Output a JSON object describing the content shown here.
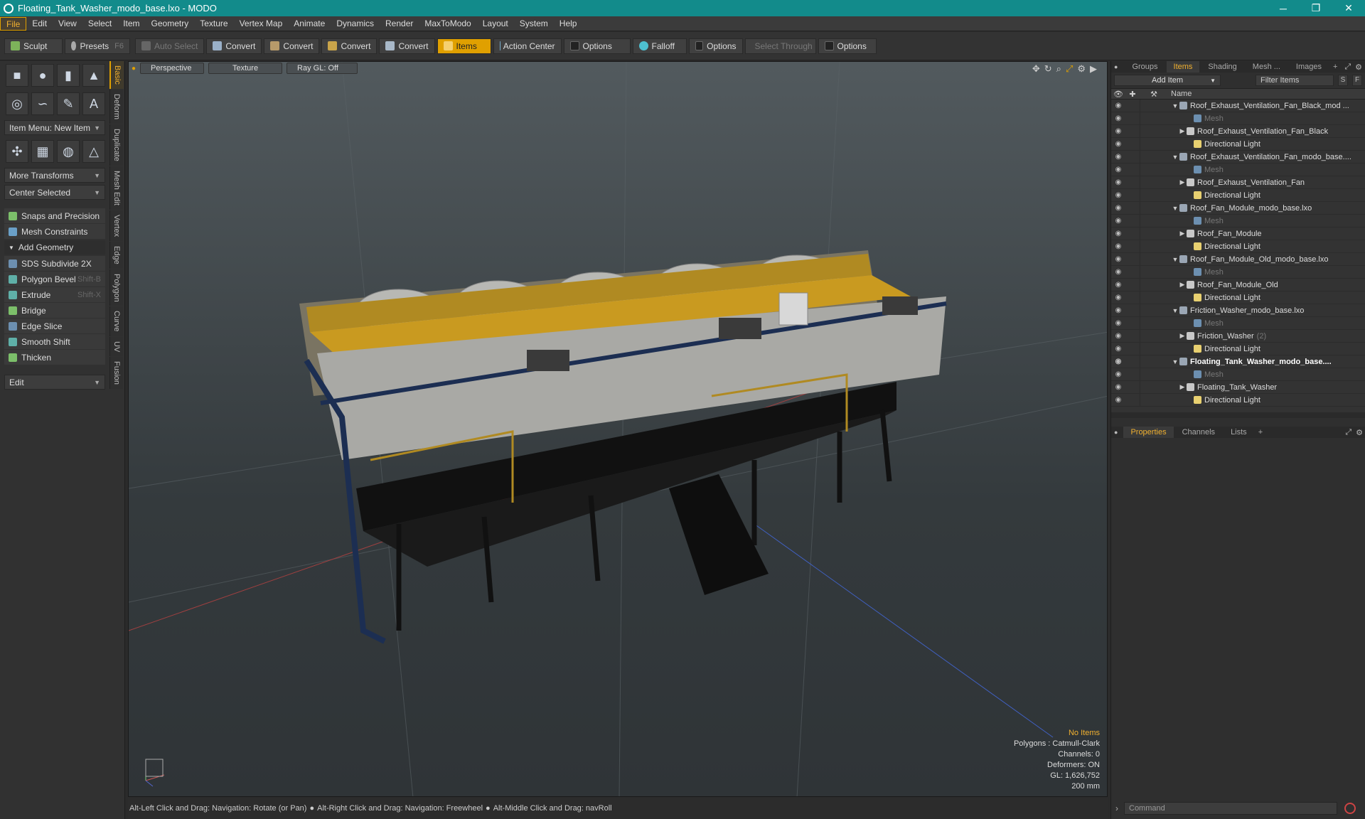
{
  "window": {
    "title": "Floating_Tank_Washer_modo_base.lxo - MODO",
    "min": "─",
    "max": "❐",
    "close": "✕"
  },
  "menu": [
    "File",
    "Edit",
    "View",
    "Select",
    "Item",
    "Geometry",
    "Texture",
    "Vertex Map",
    "Animate",
    "Dynamics",
    "Render",
    "MaxToModo",
    "Layout",
    "System",
    "Help"
  ],
  "toolbar": {
    "sculpt": "Sculpt",
    "presets": "Presets",
    "presets_key": "F6",
    "auto_select": "Auto Select",
    "convert": "Convert",
    "items": "Items",
    "action_center": "Action Center",
    "options": "Options",
    "falloff": "Falloff",
    "select_through": "Select Through"
  },
  "left": {
    "item_menu": "Item Menu: New Item",
    "more_transforms": "More Transforms",
    "center_selected": "Center Selected",
    "snaps": "Snaps and Precision",
    "mesh_constraints": "Mesh Constraints",
    "add_geometry": "Add Geometry",
    "tools": [
      {
        "label": "SDS Subdivide 2X",
        "key": ""
      },
      {
        "label": "Polygon Bevel",
        "key": "Shift-B"
      },
      {
        "label": "Extrude",
        "key": "Shift-X"
      },
      {
        "label": "Bridge",
        "key": ""
      },
      {
        "label": "Edge Slice",
        "key": ""
      },
      {
        "label": "Smooth Shift",
        "key": ""
      },
      {
        "label": "Thicken",
        "key": ""
      }
    ],
    "edit": "Edit",
    "vtabs": [
      "Basic",
      "Deform",
      "Duplicate",
      "Mesh Edit",
      "Vertex",
      "Edge",
      "Polygon",
      "Curve",
      "UV",
      "Fusion"
    ]
  },
  "viewport": {
    "perspective": "Perspective",
    "texture": "Texture",
    "raygl": "Ray GL: Off",
    "stats": {
      "no_items": "No Items",
      "polygons": "Polygons : Catmull-Clark",
      "channels": "Channels: 0",
      "deformers": "Deformers: ON",
      "gl": "GL: 1,626,752",
      "size": "200 mm"
    }
  },
  "status": {
    "hint1": "Alt-Left Click and Drag: Navigation: Rotate (or Pan)",
    "hint2": "Alt-Right Click and Drag: Navigation: Freewheel",
    "hint3": "Alt-Middle Click and Drag: navRoll"
  },
  "right": {
    "tabs": [
      "Groups",
      "Items",
      "Shading",
      "Mesh ...",
      "Images",
      "+"
    ],
    "add_item": "Add Item",
    "filter": "Filter Items",
    "s": "S",
    "f": "F",
    "name_col": "Name",
    "rows": [
      {
        "label": "Roof_Exhaust_Ventilation_Fan_Black_mod ...",
        "type": "scene",
        "indent": 0,
        "arrow": "▼"
      },
      {
        "label": "Mesh",
        "type": "mesh",
        "indent": 2,
        "arrow": ""
      },
      {
        "label": "Roof_Exhaust_Ventilation_Fan_Black",
        "type": "item",
        "indent": 1,
        "arrow": "▶"
      },
      {
        "label": "Directional Light",
        "type": "light",
        "indent": 2,
        "arrow": ""
      },
      {
        "label": "Roof_Exhaust_Ventilation_Fan_modo_base....",
        "type": "scene",
        "indent": 0,
        "arrow": "▼"
      },
      {
        "label": "Mesh",
        "type": "mesh",
        "indent": 2,
        "arrow": ""
      },
      {
        "label": "Roof_Exhaust_Ventilation_Fan",
        "type": "item",
        "indent": 1,
        "arrow": "▶"
      },
      {
        "label": "Directional Light",
        "type": "light",
        "indent": 2,
        "arrow": ""
      },
      {
        "label": "Roof_Fan_Module_modo_base.lxo",
        "type": "scene",
        "indent": 0,
        "arrow": "▼"
      },
      {
        "label": "Mesh",
        "type": "mesh",
        "indent": 2,
        "arrow": ""
      },
      {
        "label": "Roof_Fan_Module",
        "type": "item",
        "indent": 1,
        "arrow": "▶"
      },
      {
        "label": "Directional Light",
        "type": "light",
        "indent": 2,
        "arrow": ""
      },
      {
        "label": "Roof_Fan_Module_Old_modo_base.lxo",
        "type": "scene",
        "indent": 0,
        "arrow": "▼"
      },
      {
        "label": "Mesh",
        "type": "mesh",
        "indent": 2,
        "arrow": ""
      },
      {
        "label": "Roof_Fan_Module_Old",
        "type": "item",
        "indent": 1,
        "arrow": "▶"
      },
      {
        "label": "Directional Light",
        "type": "light",
        "indent": 2,
        "arrow": ""
      },
      {
        "label": "Friction_Washer_modo_base.lxo",
        "type": "scene",
        "indent": 0,
        "arrow": "▼"
      },
      {
        "label": "Mesh",
        "type": "mesh",
        "indent": 2,
        "arrow": ""
      },
      {
        "label": "Friction_Washer",
        "type": "item",
        "indent": 1,
        "arrow": "▶",
        "count": "(2)"
      },
      {
        "label": "Directional Light",
        "type": "light",
        "indent": 2,
        "arrow": ""
      },
      {
        "label": "Floating_Tank_Washer_modo_base....",
        "type": "scene",
        "indent": 0,
        "arrow": "▼",
        "bold": true
      },
      {
        "label": "Mesh",
        "type": "mesh",
        "indent": 2,
        "arrow": ""
      },
      {
        "label": "Floating_Tank_Washer",
        "type": "item",
        "indent": 1,
        "arrow": "▶"
      },
      {
        "label": "Directional Light",
        "type": "light",
        "indent": 2,
        "arrow": ""
      }
    ],
    "ptabs": [
      "Properties",
      "Channels",
      "Lists",
      "+"
    ],
    "command": "Command"
  },
  "colors": {
    "accent": "#e0a000",
    "titlebar": "#128b8b"
  }
}
